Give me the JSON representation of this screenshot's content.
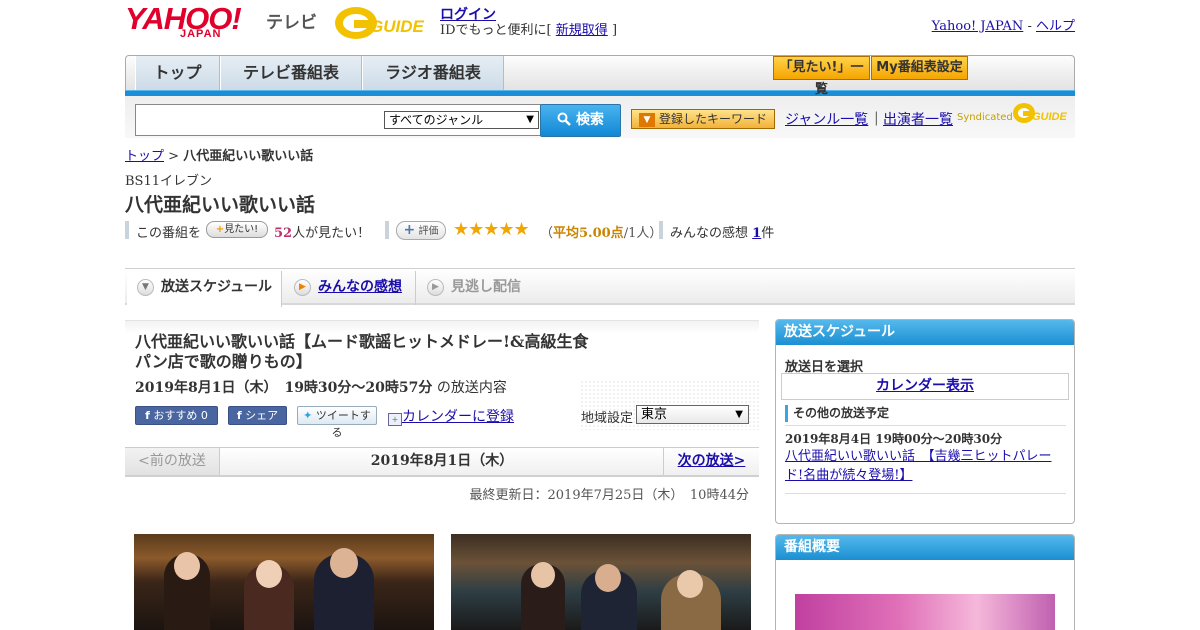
{
  "header": {
    "logo_text": "YAHOO!",
    "logo_sub": "JAPAN",
    "tv_label": "テレビ",
    "gguide_text": "GUIDE",
    "login_label": "ログイン",
    "login_sub_prefix": "IDでもっと便利に[",
    "register_label": "新規取得",
    "login_sub_suffix": "]",
    "yahoo_japan_link": "Yahoo! JAPAN",
    "separator": "-",
    "help_link": "ヘルプ"
  },
  "nav": {
    "tabs": [
      {
        "label": "トップ"
      },
      {
        "label": "テレビ番組表"
      },
      {
        "label": "ラジオ番組表"
      }
    ],
    "mitai_list": "「見たい!」一覧",
    "my_bangumi": "My番組表設定"
  },
  "search": {
    "input_value": "",
    "genre_selected": "すべてのジャンル",
    "button_label": "検索",
    "keyword_button": "登録したキーワード",
    "genre_list": "ジャンル一覧",
    "divider": "|",
    "performer_list": "出演者一覧",
    "syndicated": "Syndicated"
  },
  "breadcrumb": {
    "home": "トップ",
    "sep": ">",
    "current": "八代亜紀いい歌いい話"
  },
  "program": {
    "channel": "BS11イレブン",
    "title": "八代亜紀いい歌いい話",
    "mitai_prefix": "この番組を",
    "mitai_button": "見たい!",
    "mitai_count": "52",
    "mitai_suffix": "人が見たい！",
    "hyouka_button": "評価",
    "stars": "★★★★★",
    "avg_open": "（",
    "avg_label": "平均5.00点",
    "avg_rest": "/1人）",
    "kanso_prefix": "みんなの感想",
    "kanso_count": "1",
    "kanso_suffix": "件"
  },
  "section_tabs": {
    "schedule": "放送スケジュール",
    "kanso": "みんなの感想",
    "minogashi": "見逃し配信"
  },
  "episode": {
    "title_line1": "八代亜紀いい歌いい話【ムード歌謡ヒットメドレー!&高級生食",
    "title_line2": "パン店で歌の贈りもの】",
    "date_bold": "2019年8月1日（木）　19時30分～20時57分",
    "date_suffix": "の放送内容",
    "fb_recommend": "おすすめ 0",
    "fb_share": "シェア",
    "tweet": "ツイートする",
    "calendar_reg": "カレンダーに登録",
    "region_label": "地域設定",
    "region_value": "東京",
    "prev": "<前の放送",
    "current": "2019年8月1日（木）",
    "next": "次の放送>",
    "last_updated": "最終更新日：2019年7月25日（木）　10時44分"
  },
  "sidebar": {
    "schedule_head": "放送スケジュール",
    "select_label": "放送日を選択",
    "calendar_button": "カレンダー表示",
    "other_label": "その他の放送予定",
    "other_date": "2019年8月4日  19時00分～20時30分",
    "other_link": "八代亜紀いい歌いい話　【吉幾三ヒットパレード!名曲が続々登場!】",
    "overview_head": "番組概要"
  },
  "colors": {
    "accent_blue": "#1a8ed6",
    "brand_red": "#e0002b",
    "link": "#1a0dab",
    "star": "#f2a600"
  }
}
